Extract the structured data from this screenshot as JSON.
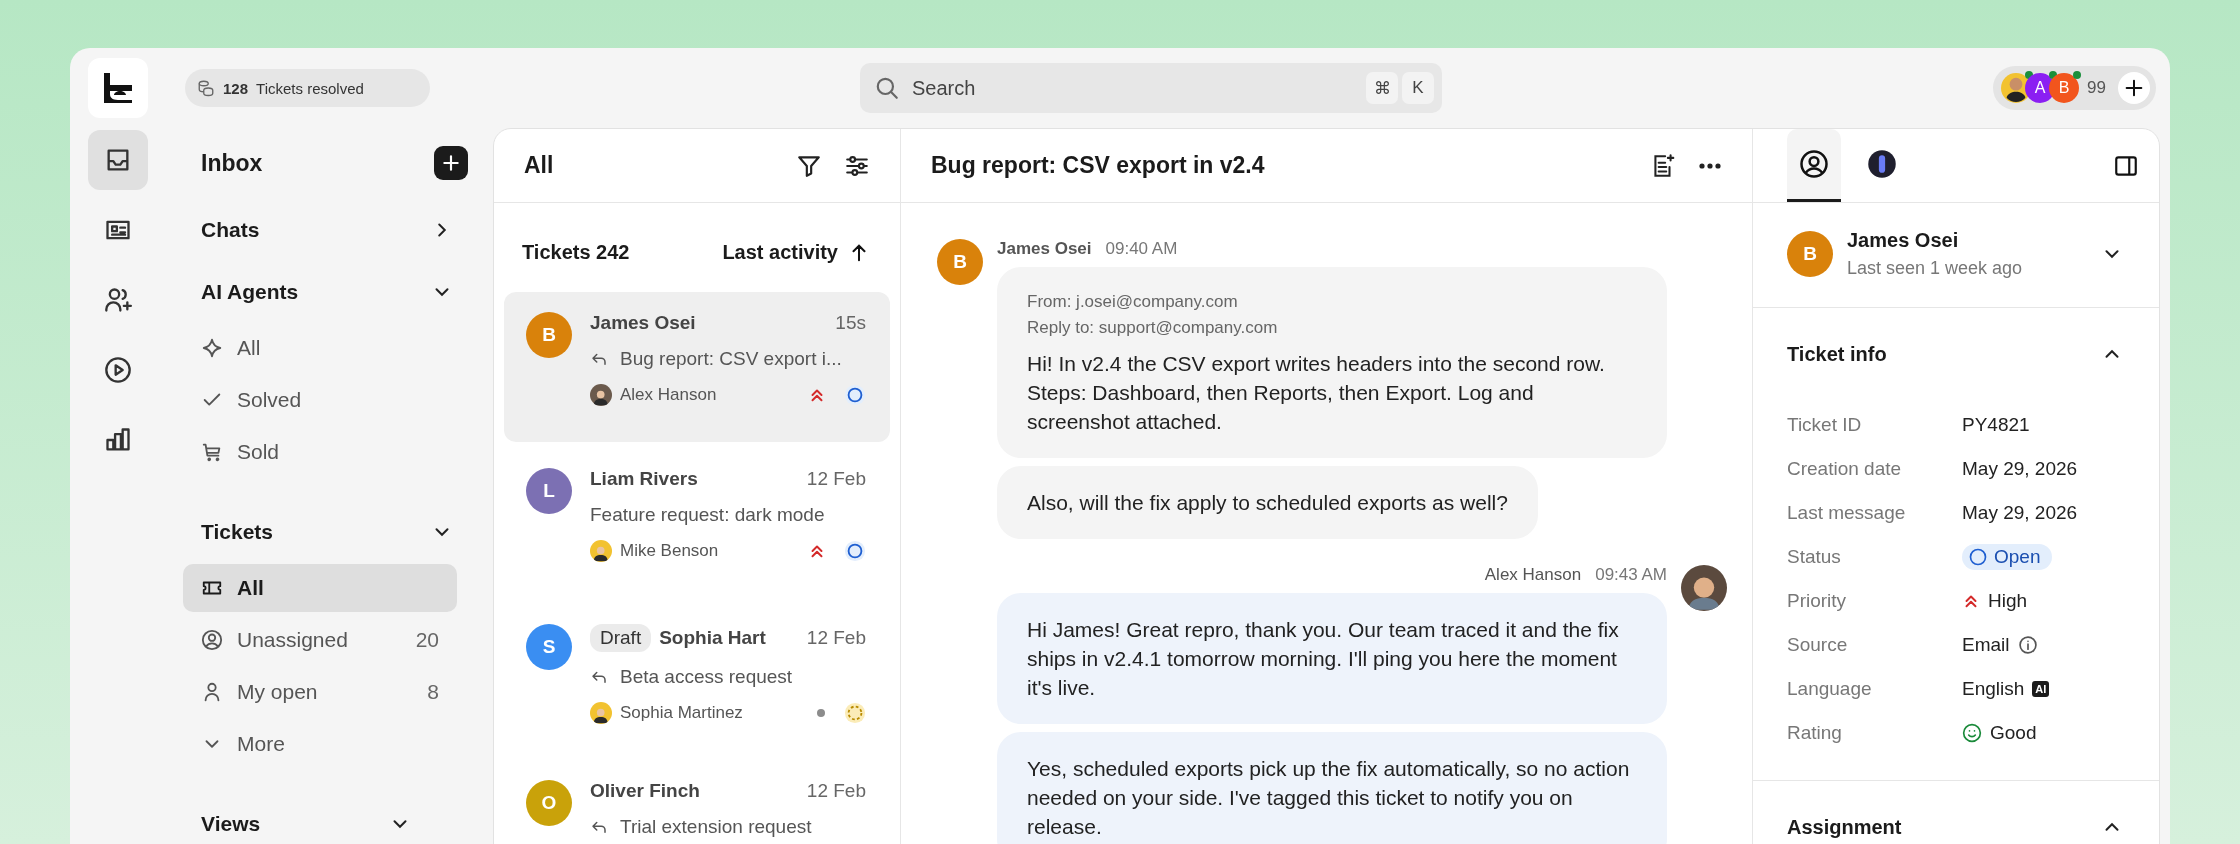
{
  "topbar": {
    "resolved_count": "128",
    "resolved_label": "Tickets resolved",
    "search_placeholder": "Search",
    "shortcut_keys": [
      "⌘",
      "K"
    ],
    "presence": [
      {
        "kind": "photo"
      },
      {
        "kind": "letter",
        "letter": "A",
        "color": "#8b1ff2"
      },
      {
        "kind": "letter",
        "letter": "B",
        "color": "#f2551d"
      }
    ],
    "presence_count": "99"
  },
  "rail": [
    {
      "kind": "inbox",
      "selected": true
    },
    {
      "kind": "contact",
      "selected": false
    },
    {
      "kind": "users",
      "selected": false
    },
    {
      "kind": "play",
      "selected": false
    },
    {
      "kind": "chart",
      "selected": false
    }
  ],
  "sidebar": {
    "title": "Inbox",
    "sections": [
      {
        "title": "Chats",
        "expanded": false
      },
      {
        "title": "AI Agents",
        "expanded": true,
        "items": [
          {
            "kind": "sparkle",
            "label": "All",
            "selected": false
          },
          {
            "kind": "check",
            "label": "Solved",
            "selected": false
          },
          {
            "kind": "cart",
            "label": "Sold",
            "selected": false
          }
        ]
      },
      {
        "title": "Tickets",
        "expanded": true,
        "items": [
          {
            "kind": "ticket",
            "label": "All",
            "selected": true
          },
          {
            "kind": "user-circle",
            "label": "Unassigned",
            "count": "20",
            "selected": false
          },
          {
            "kind": "user",
            "label": "My open",
            "count": "8",
            "selected": false
          },
          {
            "kind": "chevron",
            "label": "More",
            "selected": false
          }
        ]
      },
      {
        "title": "Views",
        "expanded": true
      }
    ]
  },
  "list": {
    "title": "All",
    "count_label": "Tickets 242",
    "sort_label": "Last activity",
    "tickets": [
      {
        "letter": "B",
        "color": "#d9820b",
        "name": "James Osei",
        "time": "15s",
        "replied": true,
        "subject": "Bug report: CSV export i...",
        "assignee": "Alex Hanson",
        "marks": [
          {
            "kind": "priority-high"
          },
          {
            "kind": "status-open"
          }
        ],
        "selected": true
      },
      {
        "letter": "L",
        "color": "#7c70b3",
        "name": "Liam Rivers",
        "time": "12 Feb",
        "replied": false,
        "subject": "Feature request: dark mode",
        "assignee": "Mike Benson",
        "marks": [
          {
            "kind": "priority-high"
          },
          {
            "kind": "status-open"
          }
        ],
        "selected": false
      },
      {
        "letter": "S",
        "color": "#3a8ef2",
        "badge": "Draft",
        "name": "Sophia Hart",
        "time": "12 Feb",
        "replied": true,
        "subject": "Beta access request",
        "assignee": "Sophia Martinez",
        "marks": [
          {
            "kind": "priority-none"
          },
          {
            "kind": "status-pending"
          }
        ],
        "selected": false
      },
      {
        "letter": "O",
        "color": "#c9a20a",
        "name": "Oliver Finch",
        "time": "12 Feb",
        "replied": true,
        "subject": "Trial extension request",
        "selected": false
      }
    ]
  },
  "conversation": {
    "title": "Bug report: CSV export in v2.4",
    "messages": [
      {
        "kind": "customer",
        "author": "James Osei",
        "time": "09:40 AM",
        "letter": "B",
        "color": "#d9820b",
        "bubbles": [
          {
            "from": "From: j.osei@company.com",
            "reply_to": "Reply to: support@company.com",
            "text": "Hi! In v2.4 the CSV export writes headers into the second row. Steps: Dashboard, then Reports, then Export. Log and screenshot attached."
          },
          {
            "text": "Also, will the fix apply to scheduled exports as well?"
          }
        ]
      },
      {
        "kind": "agent",
        "author": "Alex Hanson",
        "time": "09:43 AM",
        "bubbles": [
          {
            "text": "Hi James! Great repro, thank you. Our team traced it and the fix ships in v2.4.1 tomorrow morning. I'll ping you here the moment it's live."
          },
          {
            "text": "Yes, scheduled exports pick up the fix automatically, so no action needed on your side. I've tagged this ticket to notify you on release."
          }
        ]
      }
    ]
  },
  "details": {
    "tabs": [
      {
        "kind": "profile",
        "selected": true
      },
      {
        "kind": "ai",
        "selected": false
      }
    ],
    "contact": {
      "letter": "B",
      "color": "#d9820b",
      "name": "James Osei",
      "subtitle": "Last seen 1 week ago",
      "expanded": false
    },
    "ticket_info": {
      "title": "Ticket info",
      "expanded": true,
      "rows": [
        {
          "label": "Ticket ID",
          "value": "PY4821",
          "kind": "text"
        },
        {
          "label": "Creation date",
          "value": "May 29, 2026",
          "kind": "text"
        },
        {
          "label": "Last message",
          "value": "May 29, 2026",
          "kind": "text"
        },
        {
          "label": "Status",
          "value": "Open",
          "kind": "status"
        },
        {
          "label": "Priority",
          "value": "High",
          "kind": "priority"
        },
        {
          "label": "Source",
          "value": "Email",
          "kind": "info"
        },
        {
          "label": "Language",
          "value": "English",
          "kind": "ai",
          "tag": "AI"
        },
        {
          "label": "Rating",
          "value": "Good",
          "kind": "rating"
        }
      ]
    },
    "assignment": {
      "title": "Assignment",
      "expanded": true
    }
  }
}
